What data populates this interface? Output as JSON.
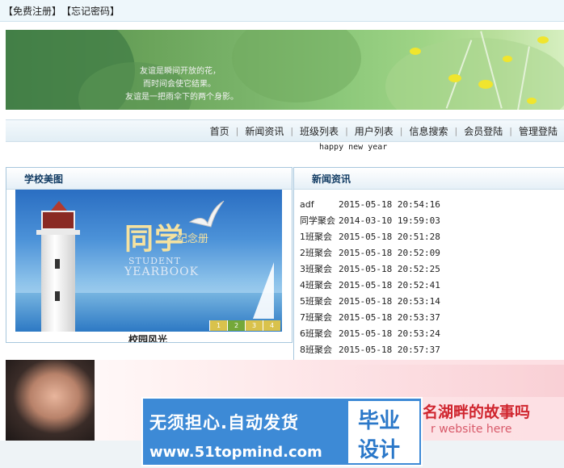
{
  "topbar": {
    "register": "【免费注册】",
    "forgot": "【忘记密码】"
  },
  "banner": {
    "poem": [
      "友谊是瞬间开放的花，",
      "而时间会使它结果。",
      "友谊是一把雨伞下的两个身影。"
    ]
  },
  "nav": {
    "items": [
      "首页",
      "新闻资讯",
      "班级列表",
      "用户列表",
      "信息搜索",
      "会员登陆",
      "管理登陆"
    ]
  },
  "marquee": "happy new year",
  "school_panel": {
    "title": "学校美图",
    "photo": {
      "title": "同学",
      "subtitle": "纪念册",
      "en1": "STUDENT",
      "en2": "YEARBOOK"
    },
    "pager": [
      "1",
      "2",
      "3",
      "4"
    ],
    "caption": "校园风光"
  },
  "news_panel": {
    "title": "新闻资讯",
    "items": [
      {
        "title": "adf",
        "date": "2015-05-18 20:54:16"
      },
      {
        "title": "同学聚会",
        "date": "2014-03-10 19:59:03"
      },
      {
        "title": "1班聚会",
        "date": "2015-05-18 20:51:28"
      },
      {
        "title": "2班聚会",
        "date": "2015-05-18 20:52:09"
      },
      {
        "title": "3班聚会",
        "date": "2015-05-18 20:52:25"
      },
      {
        "title": "4班聚会",
        "date": "2015-05-18 20:52:41"
      },
      {
        "title": "5班聚会",
        "date": "2015-05-18 20:53:14"
      },
      {
        "title": "7班聚会",
        "date": "2015-05-18 20:53:37"
      },
      {
        "title": "6班聚会",
        "date": "2015-05-18 20:53:24"
      },
      {
        "title": "8班聚会",
        "date": "2015-05-18 20:57:37"
      }
    ]
  },
  "ad": {
    "slogan": "名湖畔的故事吗",
    "site": "r website here"
  },
  "watermark": {
    "line1": "无须担心.自动发货",
    "line2": "www.51topmind.com",
    "box1": "毕业",
    "box2": "设计"
  }
}
